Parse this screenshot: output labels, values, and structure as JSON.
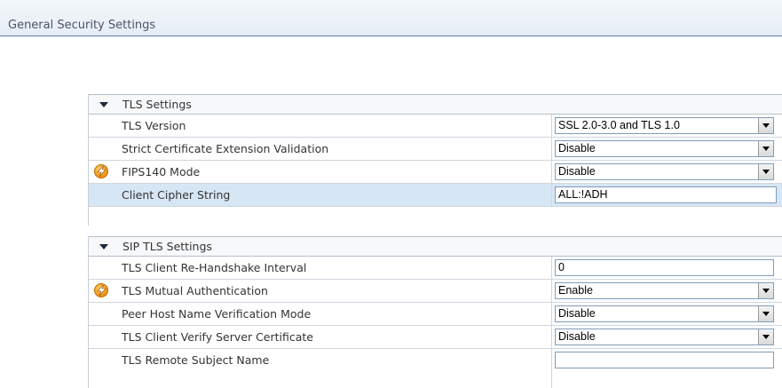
{
  "header": {
    "title": "General Security Settings"
  },
  "tls_section": {
    "title": "TLS Settings",
    "rows": [
      {
        "label": "TLS Version",
        "value": "SSL 2.0-3.0 and TLS 1.0"
      },
      {
        "label": "Strict Certificate Extension Validation",
        "value": "Disable"
      },
      {
        "label": "FIPS140 Mode",
        "value": "Disable"
      },
      {
        "label": "Client Cipher String",
        "value": "ALL:!ADH"
      }
    ]
  },
  "sip_tls_section": {
    "title": "SIP TLS Settings",
    "rows": [
      {
        "label": "TLS Client Re-Handshake Interval",
        "value": "0"
      },
      {
        "label": "TLS Mutual Authentication",
        "value": "Enable"
      },
      {
        "label": "Peer Host Name Verification Mode",
        "value": "Disable"
      },
      {
        "label": "TLS Client Verify Server Certificate",
        "value": "Disable"
      },
      {
        "label": "TLS Remote Subject Name",
        "value": ""
      }
    ]
  },
  "icons": {
    "restart_required": "lightning-bolt-icon",
    "section_toggle": "triangle-down-icon",
    "dropdown": "chevron-down-icon"
  },
  "colors": {
    "header_bg": "#e6edf5",
    "highlight_row": "#d7e6f5",
    "bolt_orange": "#f39b1c"
  }
}
